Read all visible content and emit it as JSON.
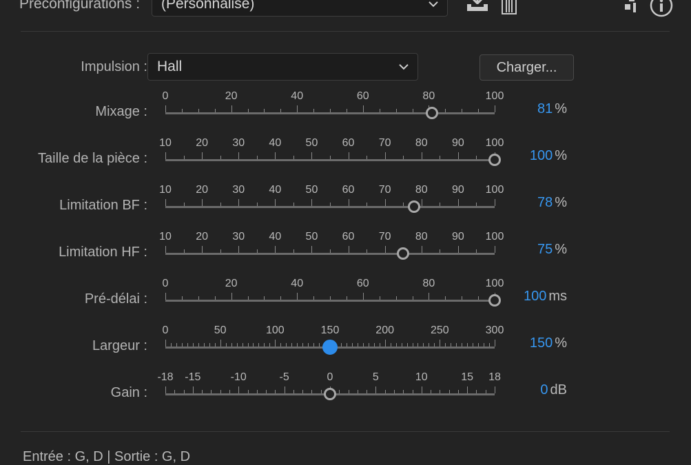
{
  "presets": {
    "label": "Préconfigurations :",
    "value": "(Personnalisé)"
  },
  "icons": {
    "save_preset": "download-tray-icon",
    "delete_preset": "trash-icon",
    "route": "routing-icon",
    "info": "info-icon"
  },
  "impulse": {
    "label": "Impulsion :",
    "value": "Hall",
    "load_label": "Charger..."
  },
  "sliders": [
    {
      "label": "Mixage :",
      "min": 0,
      "max": 100,
      "ticks": [
        "0",
        "20",
        "40",
        "60",
        "80",
        "100"
      ],
      "minor": 5,
      "value": 81,
      "display": "81",
      "unit": "%"
    },
    {
      "label": "Taille de la pièce :",
      "min": 10,
      "max": 100,
      "ticks": [
        "10",
        "20",
        "30",
        "40",
        "50",
        "60",
        "70",
        "80",
        "90",
        "100"
      ],
      "minor": 5,
      "value": 100,
      "display": "100",
      "unit": "%"
    },
    {
      "label": "Limitation BF :",
      "min": 10,
      "max": 100,
      "ticks": [
        "10",
        "20",
        "30",
        "40",
        "50",
        "60",
        "70",
        "80",
        "90",
        "100"
      ],
      "minor": 5,
      "value": 78,
      "display": "78",
      "unit": "%"
    },
    {
      "label": "Limitation HF :",
      "min": 10,
      "max": 100,
      "ticks": [
        "10",
        "20",
        "30",
        "40",
        "50",
        "60",
        "70",
        "80",
        "90",
        "100"
      ],
      "minor": 5,
      "value": 75,
      "display": "75",
      "unit": "%"
    },
    {
      "label": "Pré-délai :",
      "min": 0,
      "max": 100,
      "ticks": [
        "0",
        "20",
        "40",
        "60",
        "80",
        "100"
      ],
      "minor": 5,
      "value": 100,
      "display": "100",
      "unit": "ms"
    },
    {
      "label": "Largeur :",
      "min": 0,
      "max": 300,
      "ticks": [
        "0",
        "50",
        "100",
        "150",
        "200",
        "250",
        "300"
      ],
      "minor": 5,
      "value": 150,
      "display": "150",
      "unit": "%",
      "active": true
    },
    {
      "label": "Gain :",
      "min": -18,
      "max": 18,
      "ticks": [
        "-18",
        "-15",
        "-10",
        "-5",
        "0",
        "5",
        "10",
        "15",
        "18"
      ],
      "tick_values": [
        -18,
        -15,
        -10,
        -5,
        0,
        5,
        10,
        15,
        18
      ],
      "minor": 1,
      "value": 0,
      "display": "0",
      "unit": "dB"
    }
  ],
  "footer": {
    "io": "Entrée : G, D | Sortie : G, D"
  }
}
